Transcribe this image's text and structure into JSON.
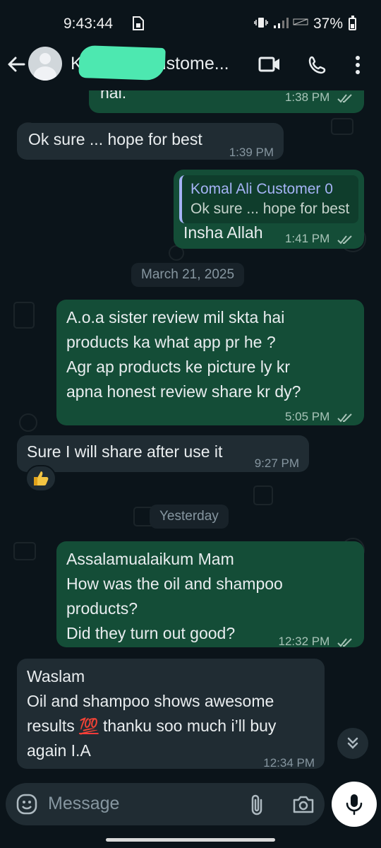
{
  "status_bar": {
    "time": "9:43:44",
    "battery": "37%",
    "icons": [
      "sim-card-icon",
      "vibrate-icon",
      "signal-icon",
      "no-sim-icon",
      "battery-icon"
    ]
  },
  "header": {
    "contact_name": "K                     ustome...",
    "icons": [
      "back-arrow-icon",
      "avatar",
      "video-call-icon",
      "phone-icon",
      "more-icon"
    ]
  },
  "messages": [
    {
      "dir": "out",
      "text": "hai.",
      "time": "1:38 PM",
      "ticks": true
    },
    {
      "dir": "in",
      "text": "Ok sure ... hope for best",
      "time": "1:39 PM"
    },
    {
      "dir": "out",
      "quote_name": "Komal Ali Customer 0",
      "quote_text": "Ok sure ... hope for best",
      "text": "Insha Allah",
      "time": "1:41 PM",
      "ticks": true
    },
    {
      "dir": "day",
      "text": "March 21, 2025"
    },
    {
      "dir": "out",
      "lines": [
        "A.o.a sister review mil skta hai",
        "products ka what app pr he ?",
        "Agr ap products ke picture ly kr",
        "apna honest review share kr dy?"
      ],
      "time": "5:05 PM",
      "ticks": true
    },
    {
      "dir": "in",
      "text": "Sure I will share after use it",
      "time": "9:27 PM",
      "reaction": "thumbs-up-icon"
    },
    {
      "dir": "day",
      "text": "Yesterday"
    },
    {
      "dir": "out",
      "lines": [
        "Assalamualaikum Mam",
        "How was the oil and shampoo",
        "products?",
        "Did they turn out good?"
      ],
      "time": "12:32 PM",
      "ticks": true
    },
    {
      "dir": "in",
      "lines": [
        "Waslam",
        "Oil and shampoo shows awesome",
        "results",
        "thanku soo much i’ll buy",
        "again I.A"
      ],
      "emoji": "💯",
      "time": "12:34 PM"
    }
  ],
  "composer": {
    "placeholder": "Message",
    "icons": [
      "emoji-icon",
      "attach-icon",
      "camera-icon",
      "mic-icon"
    ]
  },
  "colors": {
    "background": "#0b141a",
    "outgoing_bubble": "#144d37",
    "incoming_bubble": "#202c33",
    "quote_accent": "#a5b3f5"
  }
}
